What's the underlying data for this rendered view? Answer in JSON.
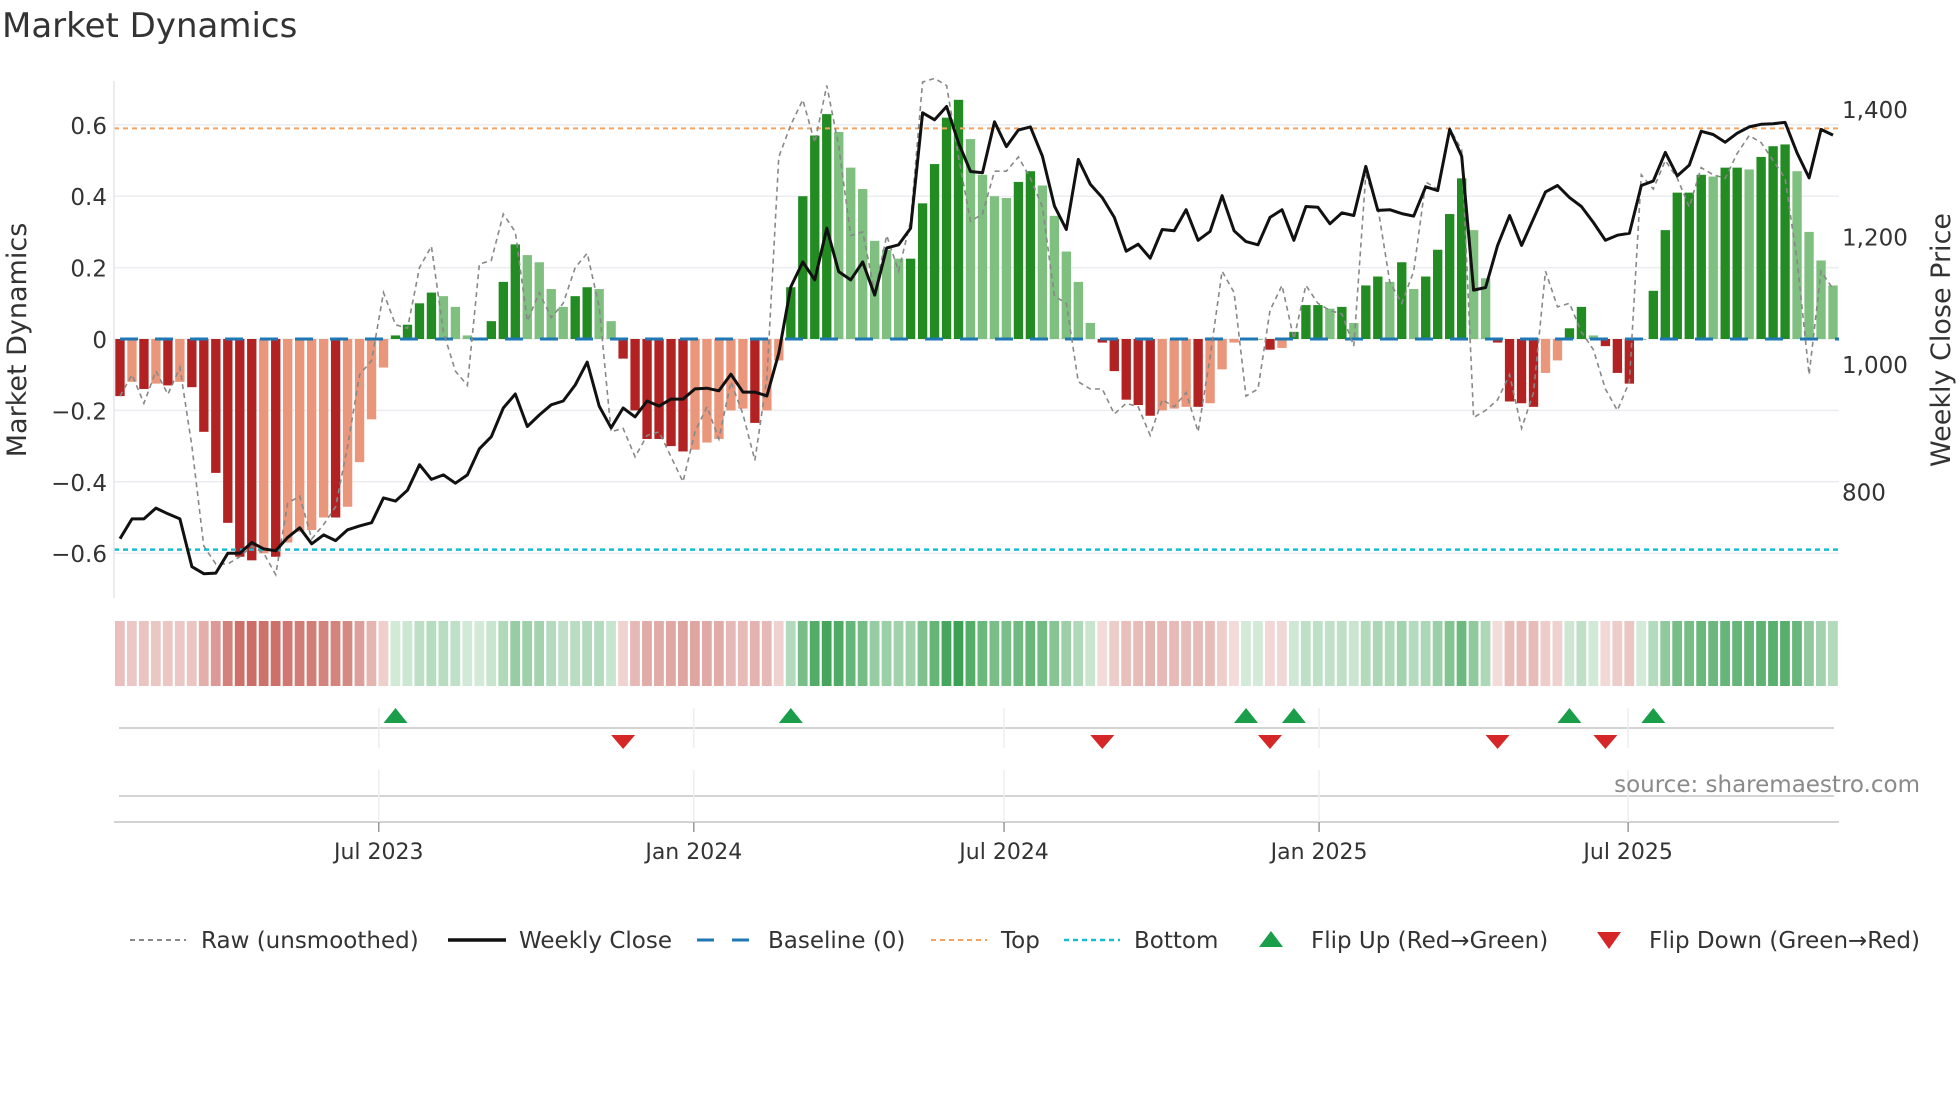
{
  "chart_data": {
    "type": "bar",
    "title": "Market Dynamics",
    "ylabel": "Market Dynamics",
    "y2label": "Weekly Close Price",
    "ylim": [
      -0.73,
      0.73
    ],
    "y2lim": [
      680,
      1450
    ],
    "yticks": [
      -0.6,
      -0.4,
      -0.2,
      0,
      0.2,
      0.4,
      0.6
    ],
    "yticklabels": [
      "−0.6",
      "−0.4",
      "−0.2",
      "0",
      "0.2",
      "0.4",
      "0.6"
    ],
    "y2ticks": [
      800,
      1000,
      1200,
      1400
    ],
    "y2ticklabels": [
      "800",
      "1,000",
      "1,200",
      "1,400"
    ],
    "xticks": [
      {
        "week": 22.6,
        "label": "Jul 2023"
      },
      {
        "week": 48.9,
        "label": "Jan 2024"
      },
      {
        "week": 74.8,
        "label": "Jul 2024"
      },
      {
        "week": 101.1,
        "label": "Jan 2025"
      },
      {
        "week": 126.9,
        "label": "Jul 2025"
      }
    ],
    "top_level": 0.59,
    "bottom_level": -0.59,
    "baseline": 0,
    "grid": true,
    "legend_position": "bottom",
    "dynamics": [
      -0.16,
      -0.12,
      -0.14,
      -0.125,
      -0.13,
      -0.12,
      -0.135,
      -0.26,
      -0.375,
      -0.515,
      -0.61,
      -0.62,
      -0.6,
      -0.61,
      -0.57,
      -0.54,
      -0.535,
      -0.5,
      -0.5,
      -0.47,
      -0.345,
      -0.225,
      -0.08,
      0.01,
      0.04,
      0.1,
      0.13,
      0.12,
      0.09,
      0.01,
      0.0,
      0.05,
      0.16,
      0.265,
      0.235,
      0.215,
      0.14,
      0.09,
      0.12,
      0.145,
      0.14,
      0.05,
      -0.055,
      -0.2,
      -0.28,
      -0.28,
      -0.3,
      -0.315,
      -0.31,
      -0.29,
      -0.28,
      -0.2,
      -0.195,
      -0.235,
      -0.2,
      -0.06,
      0.145,
      0.4,
      0.57,
      0.63,
      0.58,
      0.48,
      0.42,
      0.275,
      0.25,
      0.225,
      0.225,
      0.38,
      0.49,
      0.62,
      0.67,
      0.56,
      0.46,
      0.4,
      0.395,
      0.44,
      0.47,
      0.43,
      0.345,
      0.245,
      0.16,
      0.045,
      -0.01,
      -0.09,
      -0.17,
      -0.185,
      -0.215,
      -0.2,
      -0.195,
      -0.19,
      -0.19,
      -0.18,
      -0.085,
      -0.01,
      0.003,
      0.0,
      -0.03,
      -0.025,
      0.02,
      0.095,
      0.095,
      0.085,
      0.09,
      0.045,
      0.15,
      0.175,
      0.16,
      0.215,
      0.14,
      0.175,
      0.25,
      0.35,
      0.45,
      0.305,
      0.17,
      -0.01,
      -0.175,
      -0.18,
      -0.19,
      -0.095,
      -0.06,
      0.03,
      0.09,
      0.01,
      -0.02,
      -0.095,
      -0.125,
      0.0,
      0.135,
      0.305,
      0.41,
      0.41,
      0.46,
      0.455,
      0.48,
      0.48,
      0.475,
      0.51,
      0.54,
      0.545,
      0.47,
      0.3,
      0.22,
      0.15
    ],
    "raw": [
      -0.16,
      -0.1,
      -0.18,
      -0.09,
      -0.155,
      -0.08,
      -0.3,
      -0.58,
      -0.63,
      -0.63,
      -0.61,
      -0.58,
      -0.6,
      -0.66,
      -0.46,
      -0.44,
      -0.56,
      -0.52,
      -0.47,
      -0.3,
      -0.1,
      -0.06,
      0.13,
      0.04,
      0.03,
      0.2,
      0.26,
      0.02,
      -0.09,
      -0.13,
      0.21,
      0.22,
      0.35,
      0.3,
      0.05,
      0.13,
      0.06,
      0.1,
      0.2,
      0.24,
      0.09,
      -0.26,
      -0.25,
      -0.33,
      -0.27,
      -0.26,
      -0.33,
      -0.4,
      -0.26,
      -0.19,
      -0.28,
      -0.12,
      -0.21,
      -0.34,
      -0.11,
      0.51,
      0.6,
      0.67,
      0.55,
      0.71,
      0.54,
      0.29,
      0.3,
      0.13,
      0.29,
      0.19,
      0.33,
      0.72,
      0.73,
      0.71,
      0.51,
      0.33,
      0.35,
      0.47,
      0.47,
      0.51,
      0.45,
      0.37,
      0.12,
      0.1,
      -0.12,
      -0.14,
      -0.14,
      -0.21,
      -0.18,
      -0.19,
      -0.27,
      -0.17,
      -0.19,
      -0.15,
      -0.26,
      -0.05,
      0.19,
      0.13,
      -0.16,
      -0.14,
      0.08,
      0.15,
      0.0,
      0.15,
      0.1,
      0.08,
      0.07,
      -0.02,
      0.46,
      0.37,
      0.16,
      0.1,
      0.19,
      0.44,
      0.42,
      0.59,
      0.53,
      -0.22,
      -0.2,
      -0.17,
      -0.1,
      -0.25,
      -0.15,
      0.19,
      0.09,
      0.1,
      0.02,
      -0.03,
      -0.14,
      -0.2,
      -0.12,
      0.46,
      0.42,
      0.5,
      0.45,
      0.37,
      0.48,
      0.46,
      0.45,
      0.52,
      0.57,
      0.55,
      0.5,
      0.45,
      0.22,
      -0.1,
      0.19,
      0.14
    ],
    "close": [
      726,
      757,
      757,
      774,
      765,
      757,
      682,
      671,
      672,
      703,
      703,
      720,
      710,
      707,
      728,
      743,
      718,
      732,
      723,
      740,
      746,
      751,
      790,
      785,
      802,
      842,
      819,
      826,
      813,
      826,
      867,
      886,
      931,
      953,
      902,
      920,
      936,
      942,
      967,
      1003,
      934,
      900,
      931,
      917,
      942,
      934,
      945,
      945,
      961,
      962,
      958,
      984,
      956,
      956,
      950,
      1017,
      1121,
      1160,
      1132,
      1213,
      1145,
      1132,
      1160,
      1108,
      1182,
      1187,
      1213,
      1394,
      1383,
      1404,
      1347,
      1302,
      1300,
      1380,
      1341,
      1367,
      1372,
      1326,
      1248,
      1211,
      1321,
      1282,
      1261,
      1230,
      1177,
      1188,
      1166,
      1211,
      1209,
      1242,
      1194,
      1208,
      1264,
      1209,
      1192,
      1187,
      1230,
      1242,
      1194,
      1247,
      1246,
      1220,
      1237,
      1233,
      1310,
      1241,
      1242,
      1236,
      1232,
      1278,
      1272,
      1368,
      1326,
      1116,
      1120,
      1186,
      1233,
      1186,
      1228,
      1270,
      1280,
      1261,
      1247,
      1222,
      1194,
      1202,
      1205,
      1280,
      1287,
      1332,
      1295,
      1312,
      1365,
      1360,
      1348,
      1362,
      1372,
      1376,
      1377,
      1379,
      1331,
      1292,
      1368,
      1359
    ],
    "flip_up_weeks": [
      24,
      57,
      95,
      99,
      122,
      129
    ],
    "flip_down_weeks": [
      43,
      83,
      97,
      116,
      125
    ],
    "legend": [
      {
        "key": "raw",
        "label": "Raw (unsmoothed)"
      },
      {
        "key": "close",
        "label": "Weekly Close"
      },
      {
        "key": "baseline",
        "label": "Baseline (0)"
      },
      {
        "key": "top",
        "label": "Top"
      },
      {
        "key": "bottom",
        "label": "Bottom"
      },
      {
        "key": "flip_up",
        "label": "Flip Up (Red→Green)"
      },
      {
        "key": "flip_down",
        "label": "Flip Down (Green→Red)"
      }
    ],
    "source": "source: sharemaestro.com",
    "colors": {
      "pos_strong": "#228b22",
      "pos_weak": "#7fbf7f",
      "neg_strong": "#b22222",
      "neg_weak": "#e9967a",
      "close": "#111111",
      "raw": "#888888",
      "baseline": "#1f77b4",
      "top": "#f4a460",
      "bottom": "#17becf",
      "flip_up": "#1a9e4a",
      "flip_down": "#d62728"
    }
  }
}
